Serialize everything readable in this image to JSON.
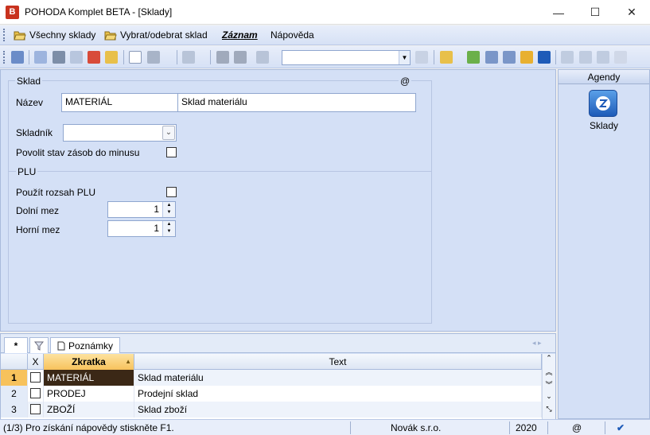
{
  "window": {
    "title": "POHODA Komplet BETA - [Sklady]",
    "app_icon_text": "B",
    "minimize": "—",
    "maximize": "☐",
    "close": "✕"
  },
  "menubar": {
    "items": [
      {
        "label": "Všechny sklady"
      },
      {
        "label": "Vybrat/odebrat sklad"
      },
      {
        "label": "Záznam"
      },
      {
        "label": "Nápověda"
      }
    ]
  },
  "toolbar": {
    "search_value": "",
    "colors": {
      "accent": "#1e5bb8",
      "bg": "#d4e0f6"
    }
  },
  "form": {
    "group_sklad": "Sklad",
    "at_symbol": "@",
    "nazev_label": "Název",
    "nazev_code": "MATERIÁL",
    "nazev_text": "Sklad materiálu",
    "skladnik_label": "Skladník",
    "skladnik_value": "",
    "povolit_label": "Povolit stav zásob do minusu",
    "group_plu": "PLU",
    "pouzit_label": "Použít rozsah PLU",
    "dolni_label": "Dolní mez",
    "dolni_value": "1",
    "horni_label": "Horní mez",
    "horni_value": "1"
  },
  "agendy": {
    "title": "Agendy",
    "item_label": "Sklady"
  },
  "tabs": {
    "star": "*",
    "poznamky": "Poznámky"
  },
  "grid": {
    "headers": {
      "x": "X",
      "zkratka": "Zkratka",
      "text": "Text"
    },
    "rows": [
      {
        "num": "1",
        "zkratka": "MATERIÁL",
        "text": "Sklad materiálu"
      },
      {
        "num": "2",
        "zkratka": "PRODEJ",
        "text": "Prodejní sklad"
      },
      {
        "num": "3",
        "zkratka": "ZBOŽÍ",
        "text": "Sklad zboží"
      }
    ]
  },
  "status": {
    "help": "(1/3) Pro získání nápovědy stiskněte F1.",
    "company": "Novák s.r.o.",
    "year": "2020",
    "at": "@"
  }
}
